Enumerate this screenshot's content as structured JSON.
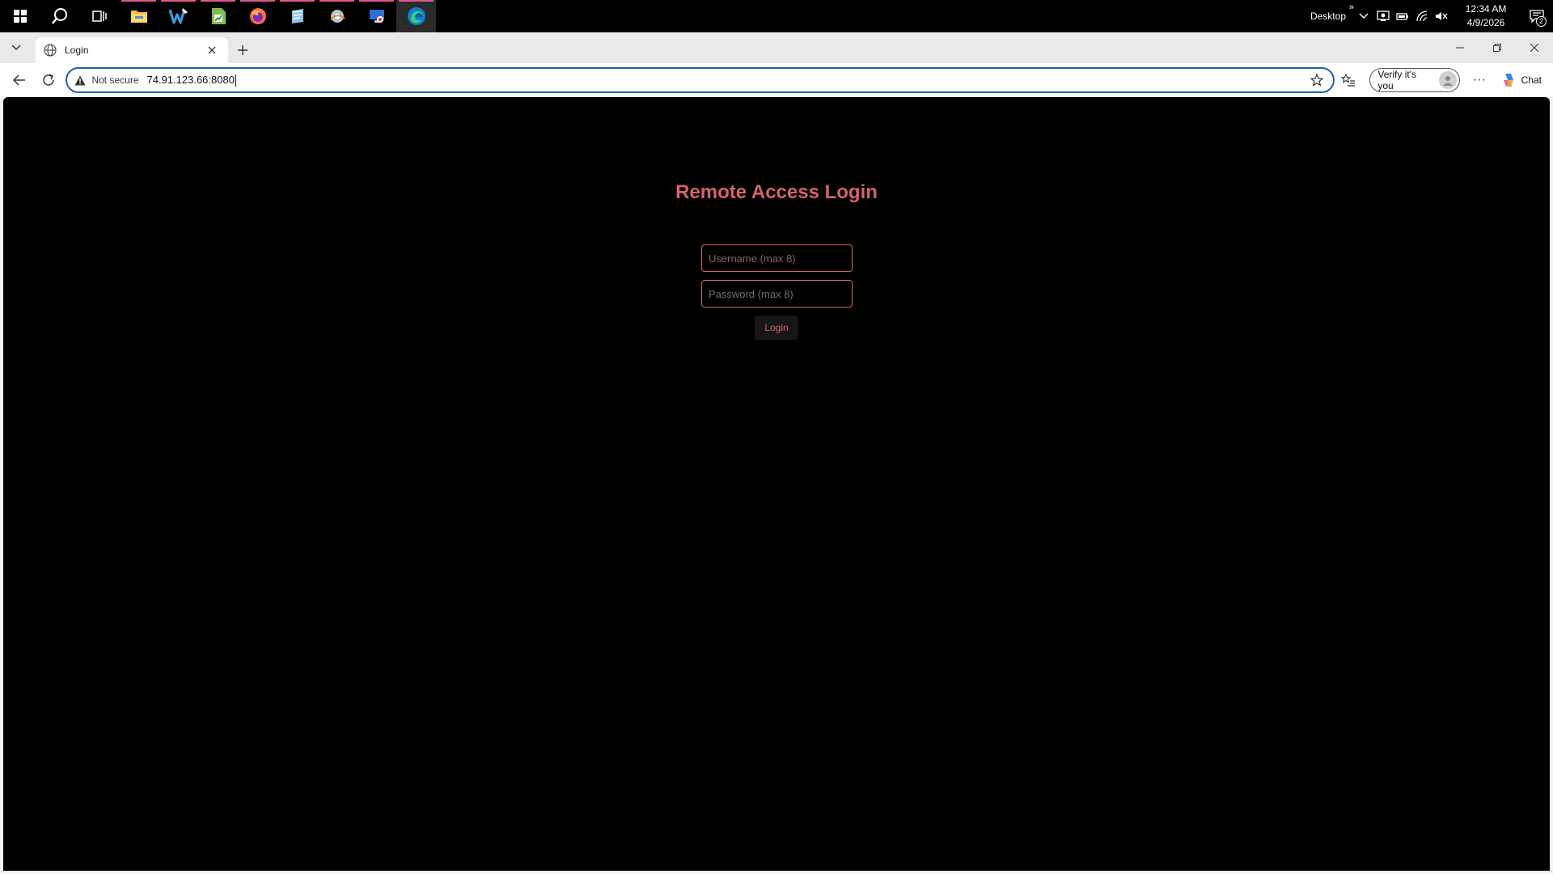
{
  "taskbar": {
    "apps": [
      {
        "name": "windows-start-icon",
        "running": false,
        "active": false
      },
      {
        "name": "search-icon",
        "running": false,
        "active": false
      },
      {
        "name": "task-view-icon",
        "running": false,
        "active": false
      },
      {
        "name": "file-explorer-icon",
        "running": true,
        "active": false
      },
      {
        "name": "writer-app-icon",
        "running": true,
        "active": false
      },
      {
        "name": "spreadsheet-app-icon",
        "running": true,
        "active": false
      },
      {
        "name": "firefox-icon",
        "running": true,
        "active": false
      },
      {
        "name": "notes-app-icon",
        "running": true,
        "active": false
      },
      {
        "name": "settings-app-icon",
        "running": true,
        "active": false
      },
      {
        "name": "remote-desktop-icon",
        "running": true,
        "active": false
      },
      {
        "name": "edge-icon",
        "running": true,
        "active": true
      }
    ],
    "desktop_label": "Desktop",
    "desktop_chevron": "»",
    "clock_time": "12:34 AM",
    "clock_date": "4/9/2026",
    "notification_count": "2"
  },
  "browser": {
    "tab_title": "Login",
    "not_secure_label": "Not secure",
    "url": "74.91.123.66:8080",
    "verify_label": "Verify it's you",
    "chat_label": "Chat",
    "more_label": "···"
  },
  "login": {
    "title": "Remote Access Login",
    "username_placeholder": "Username (max 8)",
    "password_placeholder": "Password (max 8)",
    "button_label": "Login"
  },
  "colors": {
    "accent": "#d2636b",
    "page_background": "#000000",
    "address_focus": "#1f5fb5"
  }
}
